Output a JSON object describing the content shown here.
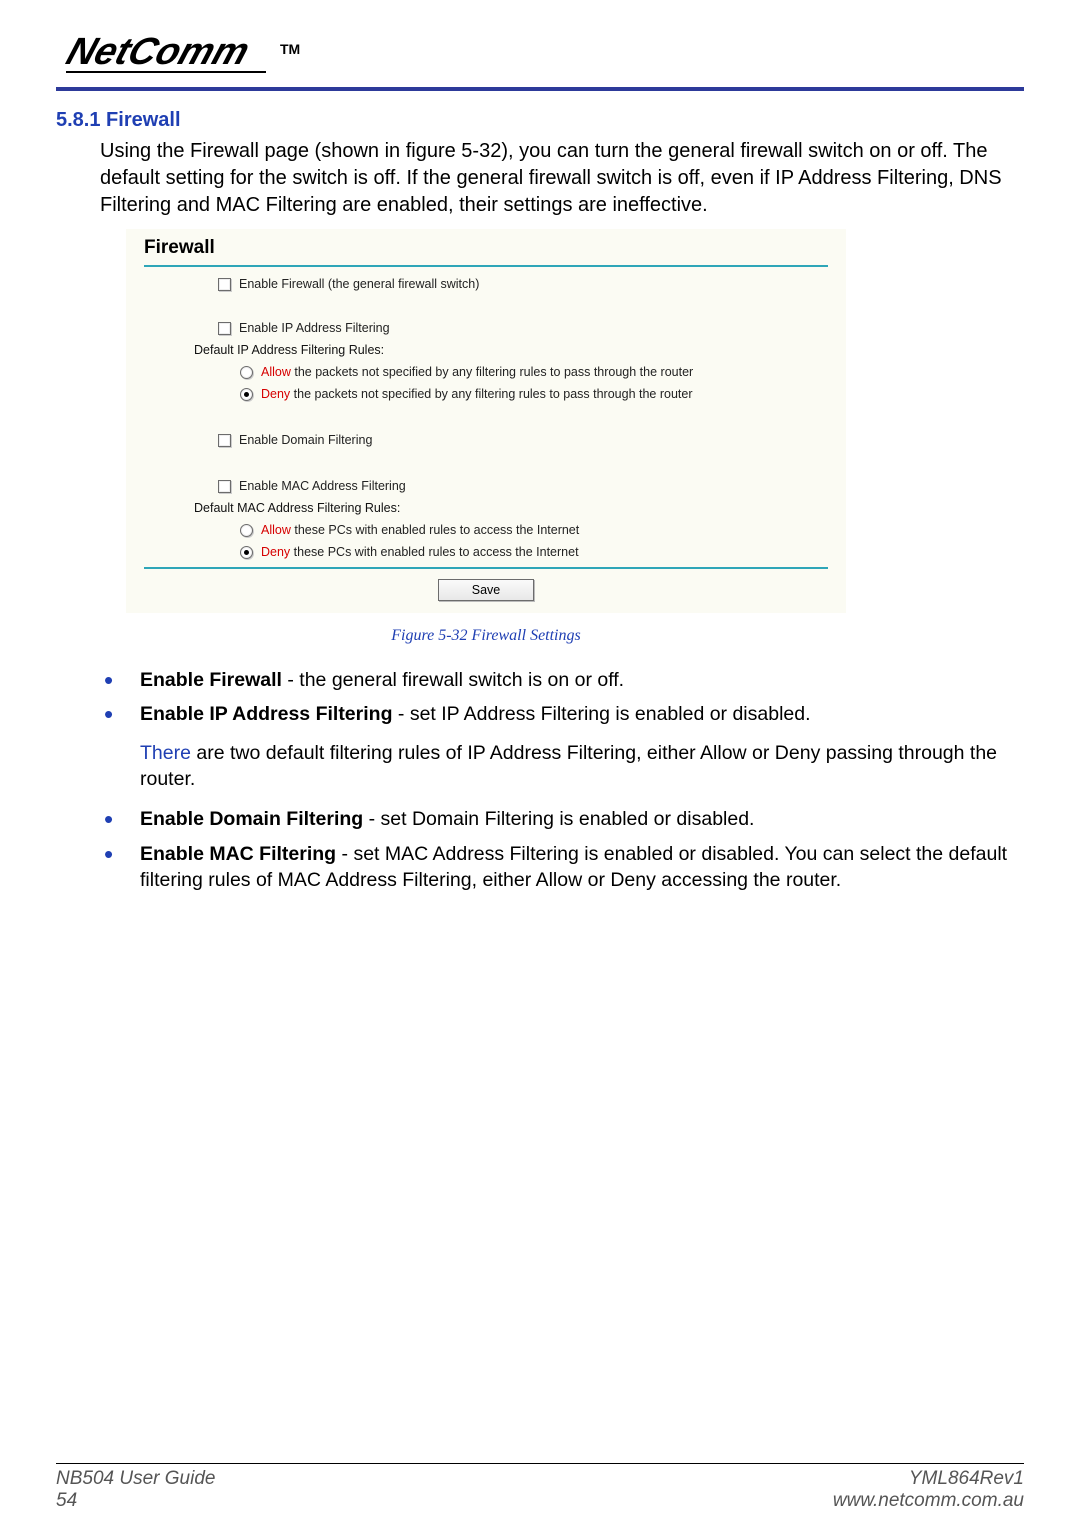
{
  "brand": {
    "name": "NetComm",
    "tm": "TM"
  },
  "heading": "5.8.1 Firewall",
  "intro": "Using the Firewall page (shown in figure 5-32), you can turn the general firewall switch on or off. The default setting for the switch is off. If the general firewall switch is off, even if IP Address Filtering, DNS Filtering and MAC Filtering are enabled, their settings are ineffective.",
  "panel": {
    "title": "Firewall",
    "enable_firewall": "Enable Firewall (the general firewall switch)",
    "enable_ip_filter": "Enable IP Address Filtering",
    "default_ip_rules_label": "Default IP Address Filtering Rules:",
    "ip_allow": {
      "kw": "Allow",
      "rest": " the packets not specified by any filtering rules to pass through the router"
    },
    "ip_deny": {
      "kw": "Deny",
      "rest": " the packets not specified by any filtering rules to pass through the router"
    },
    "enable_domain_filter": "Enable Domain Filtering",
    "enable_mac_filter": "Enable MAC Address Filtering",
    "default_mac_rules_label": "Default MAC Address Filtering Rules:",
    "mac_allow": {
      "kw": "Allow",
      "rest": " these PCs with enabled rules to access the Internet"
    },
    "mac_deny": {
      "kw": "Deny",
      "rest": " these PCs with enabled rules to access the Internet"
    },
    "save": "Save"
  },
  "figure_caption": "Figure 5-32 Firewall Settings",
  "bullets": {
    "b1_bold": "Enable Firewall",
    "b1_rest": " - the general firewall switch is on or off.",
    "b2_bold": "Enable IP Address Filtering",
    "b2_rest": " - set IP Address Filtering is enabled or disabled.",
    "b2_sub_link": "There",
    "b2_sub_rest": " are two default filtering rules of IP Address Filtering, either Allow or Deny passing through the router.",
    "b3_bold": "Enable Domain Filtering",
    "b3_rest": " - set Domain Filtering is enabled or disabled.",
    "b4_bold": "Enable MAC Filtering",
    "b4_rest": " - set MAC Address Filtering is enabled or disabled. You can select the default filtering rules of MAC Address Filtering, either Allow or Deny accessing the router."
  },
  "footer": {
    "left1": "NB504 User Guide",
    "left2": "54",
    "right1": "YML864Rev1",
    "right2": "www.netcomm.com.au"
  }
}
